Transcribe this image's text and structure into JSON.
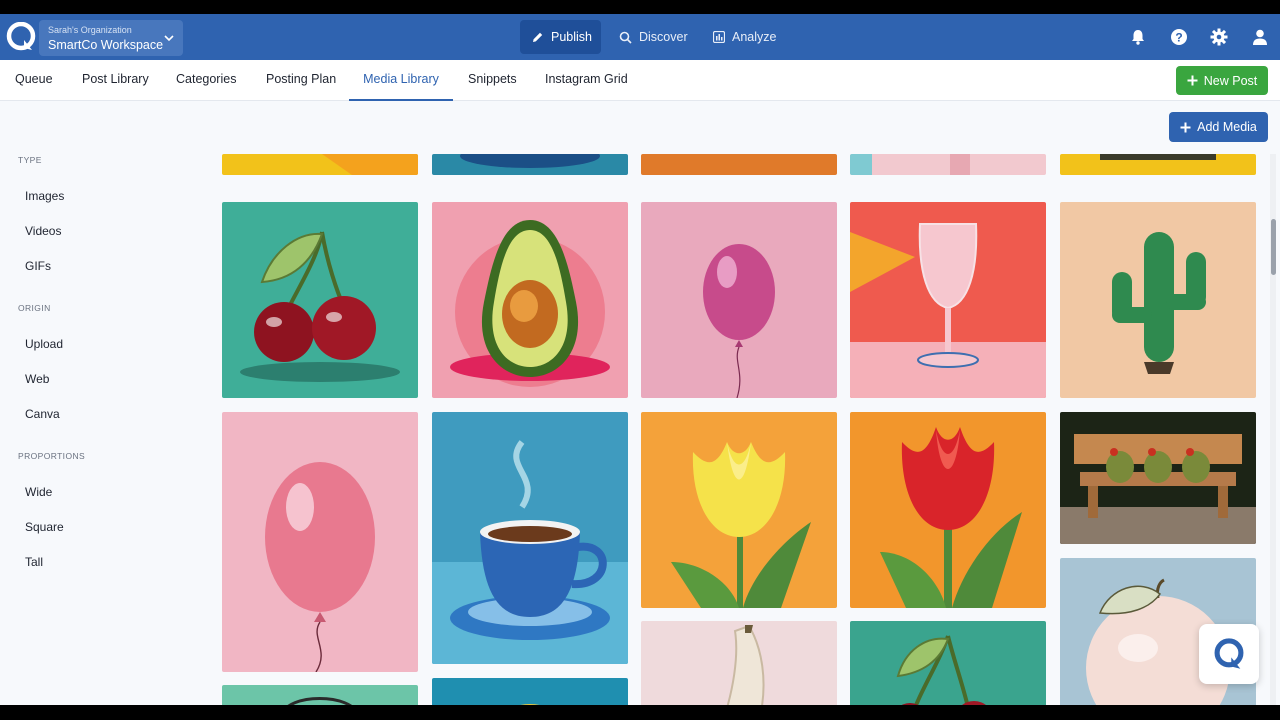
{
  "workspace": {
    "org": "Sarah's Organization",
    "name": "SmartCo Workspace"
  },
  "topnav": {
    "publish": "Publish",
    "discover": "Discover",
    "analyze": "Analyze"
  },
  "tabs": [
    "Queue",
    "Post Library",
    "Categories",
    "Posting Plan",
    "Media Library",
    "Snippets",
    "Instagram Grid"
  ],
  "active_tab": "Media Library",
  "buttons": {
    "new_post": "New Post",
    "add_media": "Add Media"
  },
  "sidebar": {
    "type_label": "TYPE",
    "type_items": [
      "Images",
      "Videos",
      "GIFs"
    ],
    "origin_label": "ORIGIN",
    "origin_items": [
      "Upload",
      "Web",
      "Canva"
    ],
    "proportions_label": "PROPORTIONS",
    "proportions_items": [
      "Wide",
      "Square",
      "Tall"
    ]
  },
  "media": [
    "cherries",
    "avocado",
    "pink-balloon",
    "wine-glass",
    "cactus",
    "pink-balloon-tall",
    "coffee-cup",
    "yellow-tulip",
    "red-tulip",
    "frogs-on-bench",
    "banana",
    "cherries-2",
    "peach"
  ],
  "colors": {
    "brand": "#2f63b0",
    "green": "#3aa63f"
  }
}
